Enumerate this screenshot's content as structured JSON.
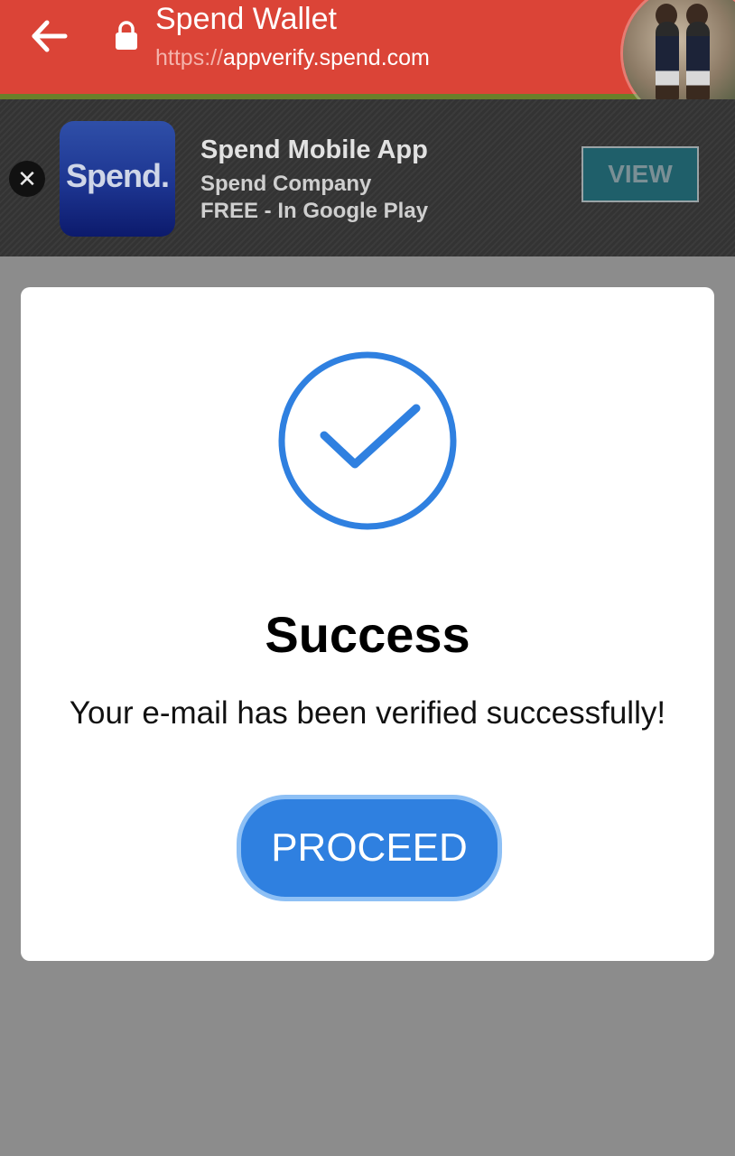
{
  "browser": {
    "title": "Spend Wallet",
    "url_scheme": "https://",
    "url_host": "appverify.spend.com",
    "bar_color": "#db4437"
  },
  "ad_banner": {
    "close_symbol": "✕",
    "logo_text": "Spend.",
    "app_name": "Spend Mobile App",
    "company": "Spend Company",
    "store_info": "FREE - In Google Play",
    "view_label": "VIEW"
  },
  "modal": {
    "icon": "check-circle-icon",
    "title": "Success",
    "message": "Your e-mail has been verified successfully!",
    "button_label": "PROCEED",
    "accent_color": "#2f80e0"
  }
}
